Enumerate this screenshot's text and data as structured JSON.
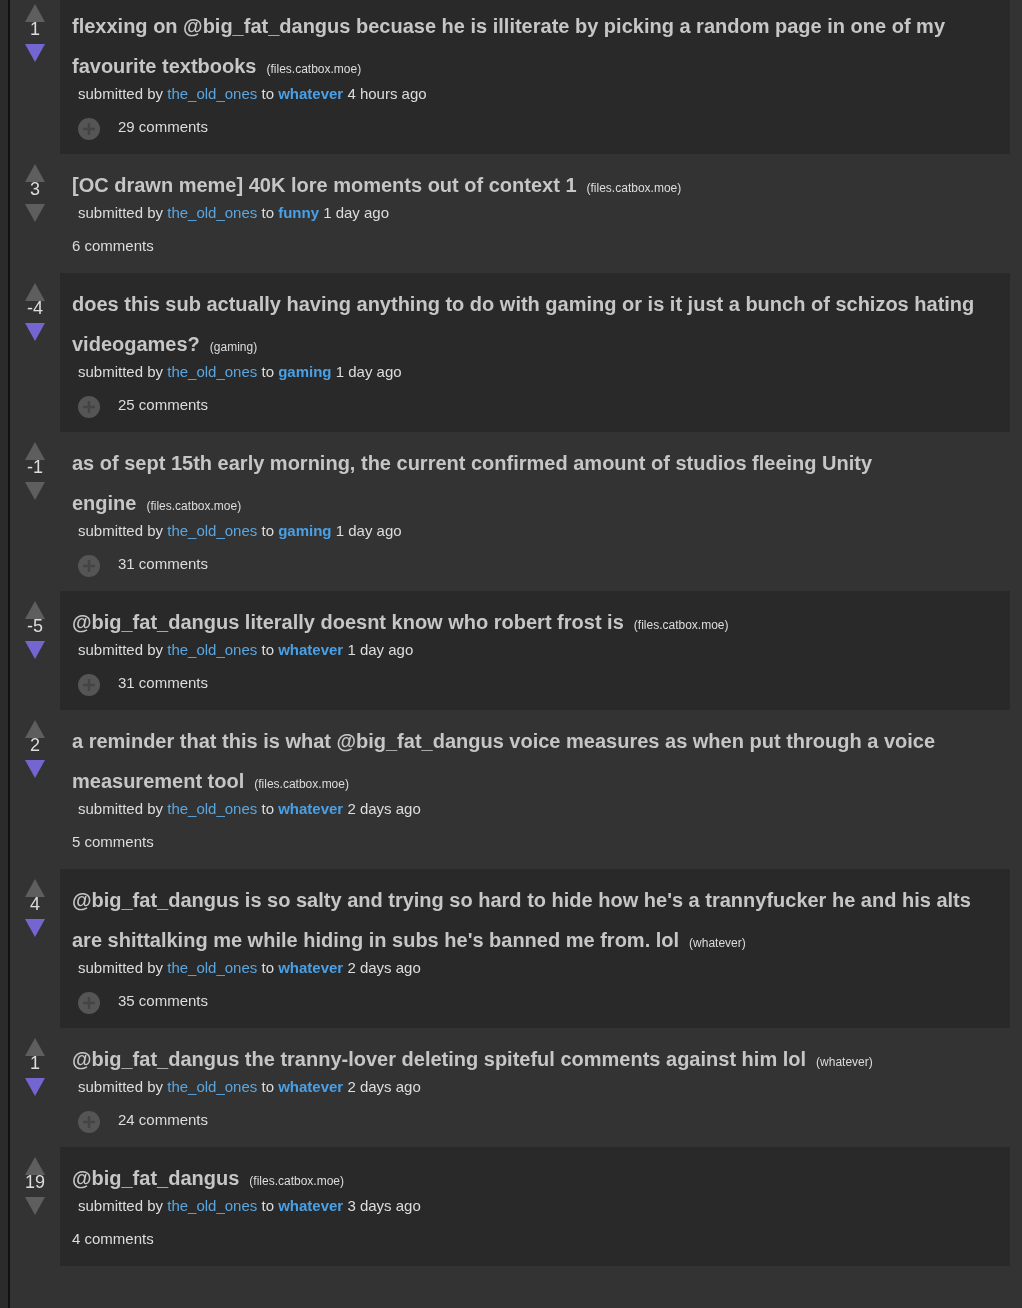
{
  "posts": [
    {
      "score": "1",
      "upvoted": false,
      "downvoted": true,
      "title": "flexxing on @big_fat_dangus becuase he is illiterate by picking a random page in one of my favourite textbooks",
      "domain": "(files.catbox.moe)",
      "tagline": {
        "prefix": "submitted by",
        "author": "the_old_ones",
        "connector": "to",
        "subreddit": "whatever",
        "time": "4 hours ago"
      },
      "expando": true,
      "comments": "29 comments"
    },
    {
      "score": "3",
      "upvoted": false,
      "downvoted": false,
      "title": "[OC drawn meme] 40K lore moments out of context 1",
      "domain": "(files.catbox.moe)",
      "tagline": {
        "prefix": "submitted by",
        "author": "the_old_ones",
        "connector": "to",
        "subreddit": "funny",
        "time": "1 day ago"
      },
      "expando": false,
      "comments": "6 comments"
    },
    {
      "score": "-4",
      "upvoted": false,
      "downvoted": true,
      "title": "does this sub actually having anything to do with gaming or is it just a bunch of schizos hating videogames?",
      "domain": "(gaming)",
      "tagline": {
        "prefix": "submitted by",
        "author": "the_old_ones",
        "connector": "to",
        "subreddit": "gaming",
        "time": "1 day ago"
      },
      "expando": true,
      "comments": "25 comments"
    },
    {
      "score": "-1",
      "upvoted": false,
      "downvoted": false,
      "title": "as of sept 15th early morning, the current confirmed amount of studios fleeing Unity engine",
      "domain": "(files.catbox.moe)",
      "tagline": {
        "prefix": "submitted by",
        "author": "the_old_ones",
        "connector": "to",
        "subreddit": "gaming",
        "time": "1 day ago"
      },
      "expando": true,
      "comments": "31 comments"
    },
    {
      "score": "-5",
      "upvoted": false,
      "downvoted": true,
      "title": "@big_fat_dangus literally doesnt know who robert frost is",
      "domain": "(files.catbox.moe)",
      "tagline": {
        "prefix": "submitted by",
        "author": "the_old_ones",
        "connector": "to",
        "subreddit": "whatever",
        "time": "1 day ago"
      },
      "expando": true,
      "comments": "31 comments"
    },
    {
      "score": "2",
      "upvoted": false,
      "downvoted": true,
      "title": "a reminder that this is what @big_fat_dangus voice measures as when put through a voice measurement tool",
      "domain": "(files.catbox.moe)",
      "tagline": {
        "prefix": "submitted by",
        "author": "the_old_ones",
        "connector": "to",
        "subreddit": "whatever",
        "time": "2 days ago"
      },
      "expando": false,
      "comments": "5 comments"
    },
    {
      "score": "4",
      "upvoted": false,
      "downvoted": true,
      "title": "@big_fat_dangus is so salty and trying so hard to hide how he's a trannyfucker he and his alts are shittalking me while hiding in subs he's banned me from. lol",
      "domain": "(whatever)",
      "tagline": {
        "prefix": "submitted by",
        "author": "the_old_ones",
        "connector": "to",
        "subreddit": "whatever",
        "time": "2 days ago"
      },
      "expando": true,
      "comments": "35 comments"
    },
    {
      "score": "1",
      "upvoted": false,
      "downvoted": true,
      "title": "@big_fat_dangus the tranny-lover deleting spiteful comments against him lol",
      "domain": "(whatever)",
      "tagline": {
        "prefix": "submitted by",
        "author": "the_old_ones",
        "connector": "to",
        "subreddit": "whatever",
        "time": "2 days ago"
      },
      "expando": true,
      "comments": "24 comments"
    },
    {
      "score": "19",
      "upvoted": false,
      "downvoted": false,
      "title": "@big_fat_dangus",
      "domain": "(files.catbox.moe)",
      "tagline": {
        "prefix": "submitted by",
        "author": "the_old_ones",
        "connector": "to",
        "subreddit": "whatever",
        "time": "3 days ago"
      },
      "expando": false,
      "comments": "4 comments"
    }
  ]
}
